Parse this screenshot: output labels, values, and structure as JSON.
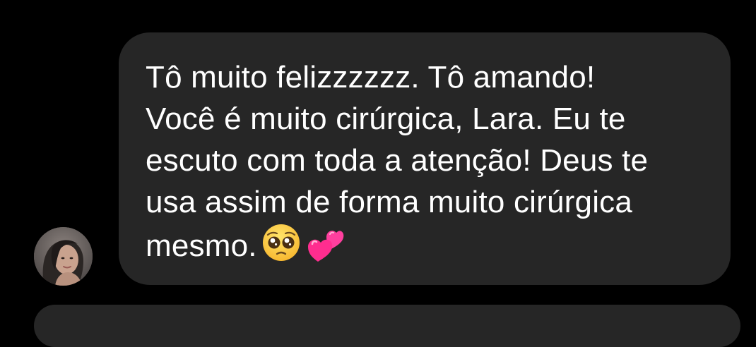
{
  "thread": {
    "message": {
      "lines": [
        "Tô muito felizzzzzz. Tô amando!",
        "Você é muito cirúrgica, Lara. Eu te",
        "escuto com toda a atenção! Deus te",
        "usa assim de forma muito cirúrgica",
        "mesmo."
      ],
      "emojis": [
        "pleading-face-emoji",
        "revolving-hearts-emoji"
      ]
    },
    "avatar": {
      "icon": "profile-photo"
    },
    "colors": {
      "background": "#000000",
      "bubble": "#262626",
      "text": "#ffffff"
    }
  }
}
